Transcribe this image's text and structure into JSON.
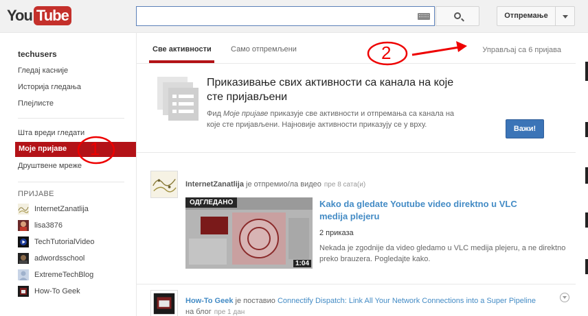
{
  "header": {
    "logo_you": "You",
    "logo_tube": "Tube",
    "search_value": "",
    "upload_label": "Отпремање"
  },
  "sidebar": {
    "username": "techusers",
    "library": [
      "Гледај касније",
      "Историја гледања",
      "Плејлисте"
    ],
    "discover": [
      "Шта вреди гледати",
      "Моје пријаве",
      "Друштвене мреже"
    ],
    "active_item": "Моје пријаве",
    "subscriptions_heading": "ПРИЈАВЕ",
    "subscriptions": [
      {
        "name": "InternetZanatlija",
        "icon": "sketch-avatar"
      },
      {
        "name": "lisa3876",
        "icon": "photo-avatar"
      },
      {
        "name": "TechTutorialVideo",
        "icon": "play-logo-avatar"
      },
      {
        "name": "adwordsschool",
        "icon": "dark-avatar"
      },
      {
        "name": "ExtremeTechBlog",
        "icon": "default-user-avatar"
      },
      {
        "name": "How-To Geek",
        "icon": "geek-avatar"
      }
    ]
  },
  "tabs": {
    "all": "Све активности",
    "uploads": "Само отпремљени",
    "manage": "Управљај са 6 пријава"
  },
  "promo": {
    "title": "Приказивање свих активности са канала на које сте пријављени",
    "text_before": "Фид ",
    "text_em": "Моје пријаве",
    "text_after": " приказује све активности и отпремања са канала на које сте пријављени. Најновије активности приказују се у врху.",
    "button": "Важи!"
  },
  "feed": [
    {
      "user": "InternetZanatlija",
      "action": " је отпремио/ла видео",
      "time": "пре 8 сата(и)",
      "watched_label": "ОДГЛЕДАНО",
      "duration": "1:04",
      "title": "Kako da gledate Youtube video direktno u VLC medija plejeru",
      "views": "2 приказа",
      "description": "Nekada je zgodnije da video gledamo u VLC medija plejeru, a ne direktno preko brauzera. Pogledajte kako."
    },
    {
      "user": "How-To Geek",
      "action_prefix": " је поставио ",
      "link": "Connectify Dispatch: Link All Your Network Connections into a Super Pipeline",
      "action_suffix": " на блог",
      "time": "пре 1 дан"
    }
  ],
  "annotations": [
    "1",
    "2"
  ],
  "colors": {
    "accent": "#b31217",
    "link": "#438bc5",
    "annotation": "#e00000",
    "button": "#3b74b7"
  }
}
